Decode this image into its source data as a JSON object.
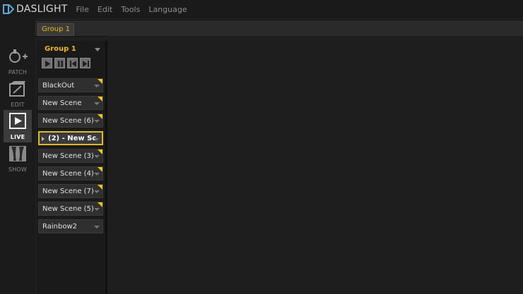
{
  "app": {
    "name": "DASLIGHT"
  },
  "menu": [
    {
      "label": "File"
    },
    {
      "label": "Edit"
    },
    {
      "label": "Tools"
    },
    {
      "label": "Language"
    }
  ],
  "group_tab": {
    "label": "Group 1"
  },
  "modes": [
    {
      "label": "PATCH",
      "icon": "patch-icon",
      "active": false
    },
    {
      "label": "EDIT",
      "icon": "edit-icon",
      "active": false
    },
    {
      "label": "LIVE",
      "icon": "live-icon",
      "active": true
    },
    {
      "label": "SHOW",
      "icon": "show-icon",
      "active": false
    }
  ],
  "scene_group": {
    "title": "Group 1",
    "transport": [
      "play-icon",
      "pause-icon",
      "previous-icon",
      "next-icon"
    ],
    "scenes": [
      {
        "label": "BlackOut",
        "playing": false
      },
      {
        "label": "New Scene",
        "playing": false
      },
      {
        "label": "New Scene (6)",
        "playing": false
      },
      {
        "label": "(2) - New Sc",
        "playing": true
      },
      {
        "label": "New Scene (3)",
        "playing": false
      },
      {
        "label": "New Scene (4)",
        "playing": false
      },
      {
        "label": "New Scene (7)",
        "playing": false
      },
      {
        "label": "New Scene (5)",
        "playing": false
      },
      {
        "label": "Rainbow2",
        "playing": false
      }
    ]
  },
  "colors": {
    "accent": "#f0b820",
    "corner": "#f0c419",
    "background": "#1f1f1f"
  }
}
